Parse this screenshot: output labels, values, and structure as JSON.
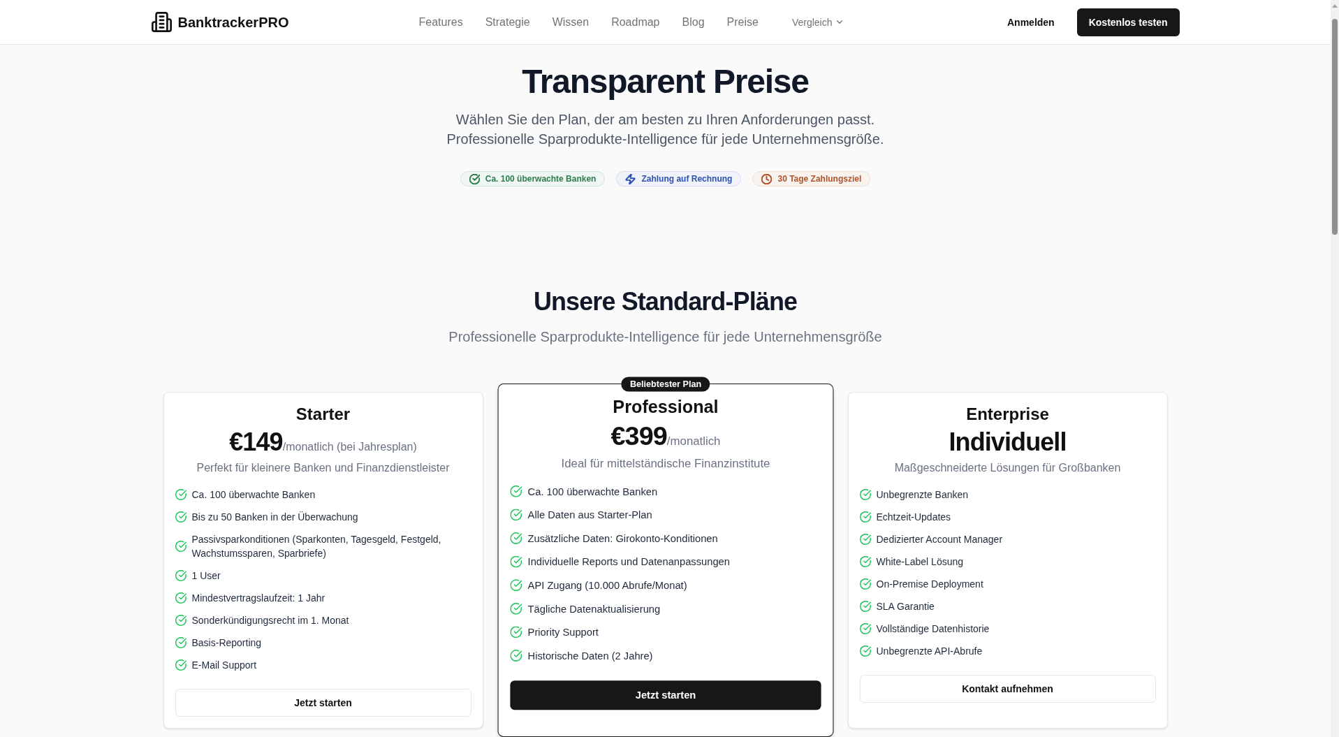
{
  "header": {
    "brand": "BanktrackerPRO",
    "nav_links": [
      "Features",
      "Strategie",
      "Wissen",
      "Roadmap",
      "Blog",
      "Preise"
    ],
    "dropdown": "Vergleich",
    "login": "Anmelden",
    "cta": "Kostenlos testen"
  },
  "hero": {
    "title": "Transparent Preise",
    "subtitle": "Wählen Sie den Plan, der am besten zu Ihren Anforderungen passt. Professionelle Sparprodukte-Intelligence für jede Unternehmensgröße.",
    "badges": [
      {
        "label": "Ca. 100 überwachte Banken",
        "color": "#2e7d4f"
      },
      {
        "label": "Zahlung auf Rechnung",
        "color": "#2f50b0"
      },
      {
        "label": "30 Tage Zahlungsziel",
        "color": "#b0532a"
      }
    ]
  },
  "plans_section": {
    "title": "Unsere Standard-Pläne",
    "subtitle": "Professionelle Sparprodukte-Intelligence für jede Unternehmensgröße",
    "plans": [
      {
        "name": "Starter",
        "price": "€149",
        "period": "/monatlich (bei Jahresplan)",
        "description": "Perfekt für kleinere Banken und Finanzdienstleister",
        "featured": false,
        "features": [
          "Ca. 100 überwachte Banken",
          "Bis zu 50 Banken in der Überwachung",
          "Passivsparkonditionen (Sparkonten, Tagesgeld, Festgeld, Wachstumssparen, Sparbriefe)",
          "1 User",
          "Mindestvertragslaufzeit: 1 Jahr",
          "Sonderkündigungsrecht im 1. Monat",
          "Basis-Reporting",
          "E-Mail Support"
        ],
        "button": "Jetzt starten"
      },
      {
        "name": "Professional",
        "badge": "Beliebtester Plan",
        "price": "€399",
        "period": "/monatlich",
        "description": "Ideal für mittelständische Finanzinstitute",
        "featured": true,
        "features": [
          "Ca. 100 überwachte Banken",
          "Alle Daten aus Starter-Plan",
          "Zusätzliche Daten: Girokonto-Konditionen",
          "Individuelle Reports und Datenanpassungen",
          "API Zugang (10.000 Abrufe/Monat)",
          "Tägliche Datenaktualisierung",
          "Priority Support",
          "Historische Daten (2 Jahre)"
        ],
        "button": "Jetzt starten"
      },
      {
        "name": "Enterprise",
        "price": "Individuell",
        "description": "Maßgeschneiderte Lösungen für Großbanken",
        "featured": false,
        "features": [
          "Unbegrenzte Banken",
          "Echtzeit-Updates",
          "Dedizierter Account Manager",
          "White-Label Lösung",
          "On-Premise Deployment",
          "SLA Garantie",
          "Vollständige Datenhistorie",
          "Unbegrenzte API-Abrufe"
        ],
        "button": "Kontakt aufnehmen"
      }
    ]
  }
}
